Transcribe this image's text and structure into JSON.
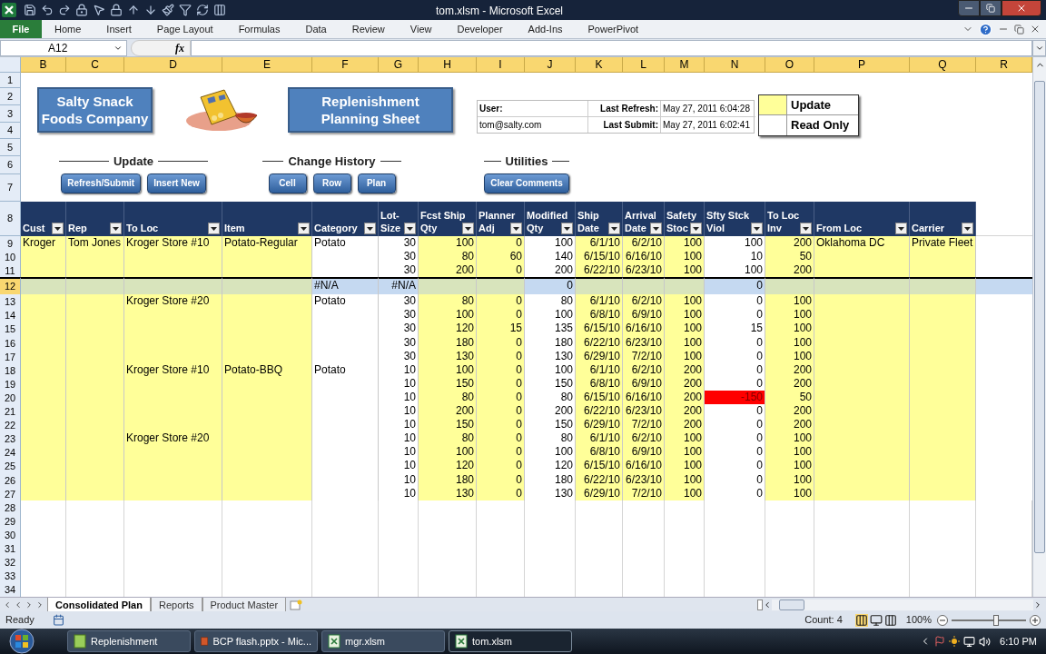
{
  "window": {
    "title": "tom.xlsm  -  Microsoft Excel"
  },
  "ribbon_tabs": [
    {
      "label": "File",
      "kind": "file"
    },
    {
      "label": "Home",
      "kind": "tab"
    },
    {
      "label": "Insert",
      "kind": "tab"
    },
    {
      "label": "Page Layout",
      "kind": "tab"
    },
    {
      "label": "Formulas",
      "kind": "tab"
    },
    {
      "label": "Data",
      "kind": "tab"
    },
    {
      "label": "Review",
      "kind": "tab"
    },
    {
      "label": "View",
      "kind": "tab"
    },
    {
      "label": "Developer",
      "kind": "tab"
    },
    {
      "label": "Add-Ins",
      "kind": "tab"
    },
    {
      "label": "PowerPivot",
      "kind": "tab"
    }
  ],
  "name_box": "A12",
  "formula_button": "fx",
  "column_letters": [
    "B",
    "C",
    "D",
    "E",
    "F",
    "G",
    "H",
    "I",
    "J",
    "K",
    "L",
    "M",
    "N",
    "O",
    "P",
    "Q",
    "R"
  ],
  "top_row_numbers": [
    "1",
    "2",
    "3",
    "4",
    "5",
    "6",
    "7"
  ],
  "company": "Salty Snack Foods Company",
  "sheet_title": "Replenishment Planning Sheet",
  "info": {
    "user_label": "User:",
    "user": "tom@salty.com",
    "refresh_label": "Last Refresh:",
    "refresh": "May 27, 2011 6:04:28",
    "submit_label": "Last Submit:",
    "submit": "May 27, 2011 6:02:41"
  },
  "legend": [
    {
      "label": "Update",
      "color": "#ffff99"
    },
    {
      "label": "Read Only",
      "color": "#ffffff"
    }
  ],
  "button_groups": [
    {
      "title": "Update",
      "buttons": [
        "Refresh/Submit",
        "Insert New"
      ]
    },
    {
      "title": "Change History",
      "buttons": [
        "Cell",
        "Row",
        "Plan"
      ]
    },
    {
      "title": "Utilities",
      "buttons": [
        "Clear Comments"
      ]
    }
  ],
  "table": {
    "header_row": "8",
    "columns": [
      {
        "lines": [
          "Cust"
        ],
        "kind": "text",
        "editable": true
      },
      {
        "lines": [
          "Rep"
        ],
        "kind": "text",
        "editable": true
      },
      {
        "lines": [
          "To Loc"
        ],
        "kind": "text",
        "editable": true
      },
      {
        "lines": [
          "Item"
        ],
        "kind": "text",
        "editable": true
      },
      {
        "lines": [
          "Category"
        ],
        "kind": "text",
        "editable": false
      },
      {
        "lines": [
          "Lot-",
          "Size"
        ],
        "kind": "number",
        "editable": false
      },
      {
        "lines": [
          "Fcst Ship",
          "Qty"
        ],
        "kind": "number",
        "editable": true
      },
      {
        "lines": [
          "Planner",
          "Adj"
        ],
        "kind": "number",
        "editable": true
      },
      {
        "lines": [
          "Modified",
          "Qty"
        ],
        "kind": "number",
        "editable": false
      },
      {
        "lines": [
          "Ship",
          "Date"
        ],
        "kind": "number",
        "editable": true
      },
      {
        "lines": [
          "Arrival",
          "Date"
        ],
        "kind": "number",
        "editable": true
      },
      {
        "lines": [
          "Safety",
          "Stoc"
        ],
        "kind": "number",
        "editable": true
      },
      {
        "lines": [
          "Sfty Stck",
          "Viol"
        ],
        "kind": "number",
        "editable": false
      },
      {
        "lines": [
          "To Loc",
          "Inv"
        ],
        "kind": "number",
        "editable": true
      },
      {
        "lines": [
          "From Loc"
        ],
        "kind": "text",
        "editable": true
      },
      {
        "lines": [
          "Carrier"
        ],
        "kind": "text",
        "editable": true
      }
    ],
    "rows": [
      {
        "row": "9",
        "selected": false,
        "alert": false,
        "cells": [
          "Kroger",
          "Tom Jones",
          "Kroger Store #10",
          "Potato-Regular",
          "Potato",
          "30",
          "100",
          "0",
          "100",
          "6/1/10",
          "6/2/10",
          "100",
          "100",
          "200",
          "Oklahoma DC",
          "Private Fleet"
        ]
      },
      {
        "row": "10",
        "selected": false,
        "alert": false,
        "cells": [
          null,
          null,
          null,
          null,
          null,
          "30",
          "80",
          "60",
          "140",
          "6/15/10",
          "6/16/10",
          "100",
          "10",
          "50",
          null,
          null
        ]
      },
      {
        "row": "11",
        "selected": false,
        "alert": false,
        "cells": [
          null,
          null,
          null,
          null,
          null,
          "30",
          "200",
          "0",
          "200",
          "6/22/10",
          "6/23/10",
          "100",
          "100",
          "200",
          null,
          null
        ]
      },
      {
        "row": "12",
        "selected": true,
        "alert": false,
        "cells": [
          null,
          null,
          null,
          null,
          "#N/A",
          "#N/A",
          null,
          null,
          "0",
          null,
          null,
          null,
          "0",
          null,
          null,
          null
        ]
      },
      {
        "row": "13",
        "selected": false,
        "alert": false,
        "cells": [
          null,
          null,
          "Kroger Store #20",
          null,
          "Potato",
          "30",
          "80",
          "0",
          "80",
          "6/1/10",
          "6/2/10",
          "100",
          "0",
          "100",
          null,
          null
        ]
      },
      {
        "row": "14",
        "selected": false,
        "alert": false,
        "cells": [
          null,
          null,
          null,
          null,
          null,
          "30",
          "100",
          "0",
          "100",
          "6/8/10",
          "6/9/10",
          "100",
          "0",
          "100",
          null,
          null
        ]
      },
      {
        "row": "15",
        "selected": false,
        "alert": false,
        "cells": [
          null,
          null,
          null,
          null,
          null,
          "30",
          "120",
          "15",
          "135",
          "6/15/10",
          "6/16/10",
          "100",
          "15",
          "100",
          null,
          null
        ]
      },
      {
        "row": "16",
        "selected": false,
        "alert": false,
        "cells": [
          null,
          null,
          null,
          null,
          null,
          "30",
          "180",
          "0",
          "180",
          "6/22/10",
          "6/23/10",
          "100",
          "0",
          "100",
          null,
          null
        ]
      },
      {
        "row": "17",
        "selected": false,
        "alert": false,
        "cells": [
          null,
          null,
          null,
          null,
          null,
          "30",
          "130",
          "0",
          "130",
          "6/29/10",
          "7/2/10",
          "100",
          "0",
          "100",
          null,
          null
        ]
      },
      {
        "row": "18",
        "selected": false,
        "alert": false,
        "cells": [
          null,
          null,
          "Kroger Store #10",
          "Potato-BBQ",
          "Potato",
          "10",
          "100",
          "0",
          "100",
          "6/1/10",
          "6/2/10",
          "200",
          "0",
          "200",
          null,
          null
        ]
      },
      {
        "row": "19",
        "selected": false,
        "alert": false,
        "cells": [
          null,
          null,
          null,
          null,
          null,
          "10",
          "150",
          "0",
          "150",
          "6/8/10",
          "6/9/10",
          "200",
          "0",
          "200",
          null,
          null
        ]
      },
      {
        "row": "20",
        "selected": false,
        "alert": true,
        "cells": [
          null,
          null,
          null,
          null,
          null,
          "10",
          "80",
          "0",
          "80",
          "6/15/10",
          "6/16/10",
          "200",
          "-150",
          "50",
          null,
          null
        ]
      },
      {
        "row": "21",
        "selected": false,
        "alert": false,
        "cells": [
          null,
          null,
          null,
          null,
          null,
          "10",
          "200",
          "0",
          "200",
          "6/22/10",
          "6/23/10",
          "200",
          "0",
          "200",
          null,
          null
        ]
      },
      {
        "row": "22",
        "selected": false,
        "alert": false,
        "cells": [
          null,
          null,
          null,
          null,
          null,
          "10",
          "150",
          "0",
          "150",
          "6/29/10",
          "7/2/10",
          "200",
          "0",
          "200",
          null,
          null
        ]
      },
      {
        "row": "23",
        "selected": false,
        "alert": false,
        "cells": [
          null,
          null,
          "Kroger Store #20",
          null,
          null,
          "10",
          "80",
          "0",
          "80",
          "6/1/10",
          "6/2/10",
          "100",
          "0",
          "100",
          null,
          null
        ]
      },
      {
        "row": "24",
        "selected": false,
        "alert": false,
        "cells": [
          null,
          null,
          null,
          null,
          null,
          "10",
          "100",
          "0",
          "100",
          "6/8/10",
          "6/9/10",
          "100",
          "0",
          "100",
          null,
          null
        ]
      },
      {
        "row": "25",
        "selected": false,
        "alert": false,
        "cells": [
          null,
          null,
          null,
          null,
          null,
          "10",
          "120",
          "0",
          "120",
          "6/15/10",
          "6/16/10",
          "100",
          "0",
          "100",
          null,
          null
        ]
      },
      {
        "row": "26",
        "selected": false,
        "alert": false,
        "cells": [
          null,
          null,
          null,
          null,
          null,
          "10",
          "180",
          "0",
          "180",
          "6/22/10",
          "6/23/10",
          "100",
          "0",
          "100",
          null,
          null
        ]
      },
      {
        "row": "27",
        "selected": false,
        "alert": false,
        "cells": [
          null,
          null,
          null,
          null,
          null,
          "10",
          "130",
          "0",
          "130",
          "6/29/10",
          "7/2/10",
          "100",
          "0",
          "100",
          null,
          null
        ]
      }
    ]
  },
  "empty_rows": [
    "28",
    "29",
    "30",
    "31",
    "32",
    "33",
    "34"
  ],
  "sheet_tabs": [
    {
      "label": "Consolidated Plan",
      "selected": true
    },
    {
      "label": "Reports",
      "selected": false
    },
    {
      "label": "Product Master",
      "selected": false
    }
  ],
  "status_bar": {
    "ready": "Ready",
    "count": "Count: 4",
    "zoom": "100%",
    "zoom_slider": {
      "level": 0.6
    }
  },
  "taskbar": {
    "items": [
      {
        "label": "Replenishment",
        "kind": "app",
        "selected": false
      },
      {
        "label": "BCP flash.pptx - Mic...",
        "kind": "slides",
        "selected": false
      },
      {
        "label": "mgr.xlsm",
        "kind": "sheet",
        "selected": false
      },
      {
        "label": "tom.xlsm",
        "kind": "sheet",
        "selected": true
      }
    ],
    "clock": "6:10 PM"
  }
}
